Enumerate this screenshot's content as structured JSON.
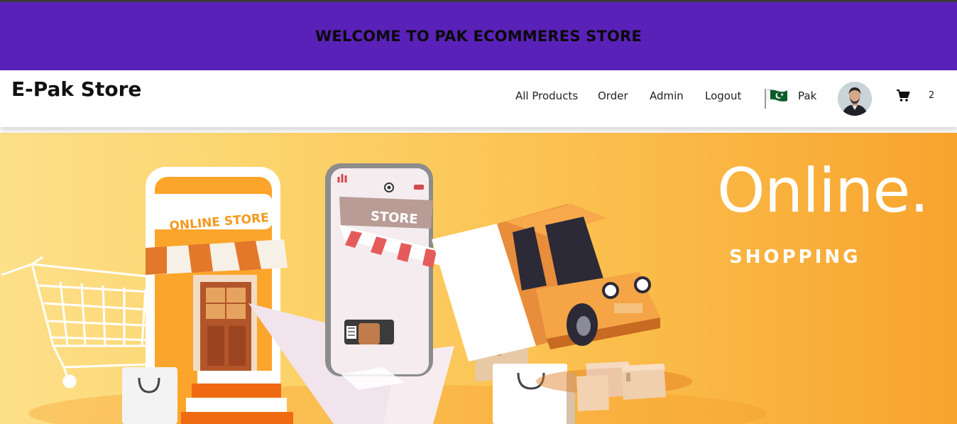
{
  "banner": {
    "text": "WELCOME TO PAK ECOMMERES STORE"
  },
  "navbar": {
    "brand": "E-Pak Store",
    "links": [
      "All Products",
      "Order",
      "Admin",
      "Logout"
    ],
    "region": {
      "label": "Pak",
      "icon": "pakistan-flag-icon"
    },
    "avatar_icon": "user-avatar",
    "cart": {
      "icon": "cart-icon",
      "count": "2"
    }
  },
  "hero": {
    "title": "Online.",
    "subtitle": "SHOPPING",
    "illustration": {
      "shop_sign": "ONLINE STORE",
      "phone_sign": "STORE"
    }
  },
  "colors": {
    "banner_bg": "#5a21b8",
    "hero_from": "#fde08a",
    "hero_to": "#f7a42e"
  }
}
